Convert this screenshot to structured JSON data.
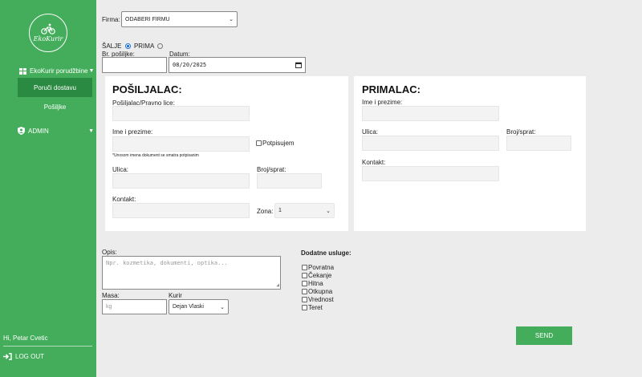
{
  "sidebar": {
    "logo_text": "EkoKurir",
    "menu_label": "EkoKurir porudžbine",
    "items": [
      {
        "label": "Poruči dostavu",
        "active": true
      },
      {
        "label": "Pošiljke",
        "active": false
      }
    ],
    "admin_label": "ADMIN",
    "greeting": "Hi, Petar Cvetic",
    "logout_label": "LOG OUT"
  },
  "form": {
    "firma_label": "Firma:",
    "firma_value": "ODABERI FIRMU",
    "salje_label": "ŠALJE",
    "prima_label": "PRIMA",
    "selected_direction": "salje",
    "br_posiljke_label": "Br. pošiljke:",
    "br_posiljke_value": "",
    "datum_label": "Datum:",
    "datum_value": "08/20/2025"
  },
  "posiljalac": {
    "title": "POŠILJALAC:",
    "pravno_lice_label": "Pošiljalac/Pravno lice:",
    "ime_label": "Ime i prezime:",
    "potpisujem_label": "Potpisujem",
    "note": "*Unosom imena dokument se smatra potpisanim",
    "ulica_label": "Ulica:",
    "broj_label": "Broj/sprat:",
    "kontakt_label": "Kontakt:",
    "zona_label": "Zona:",
    "zona_value": "1"
  },
  "primalac": {
    "title": "PRIMALAC:",
    "ime_label": "Ime i prezime:",
    "ulica_label": "Ulica:",
    "broj_label": "Broj/sprat:",
    "kontakt_label": "Kontakt:"
  },
  "details": {
    "opis_label": "Opis:",
    "opis_placeholder": "Npr. kozmetika, dokumenti, optika...",
    "masa_label": "Masa:",
    "masa_placeholder": "kg",
    "kurir_label": "Kurir",
    "kurir_value": "Dejan Vlaski",
    "usluge_title": "Dodatne usluge:",
    "usluge": [
      "Povratna",
      "Čekanje",
      "Hitna",
      "Otkupna",
      "Vrednost",
      "Teret"
    ]
  },
  "send_label": "SEND",
  "colors": {
    "brand": "#43ad5b",
    "brand_dark": "#2b8a42",
    "radio_active": "#1a6fd6"
  }
}
